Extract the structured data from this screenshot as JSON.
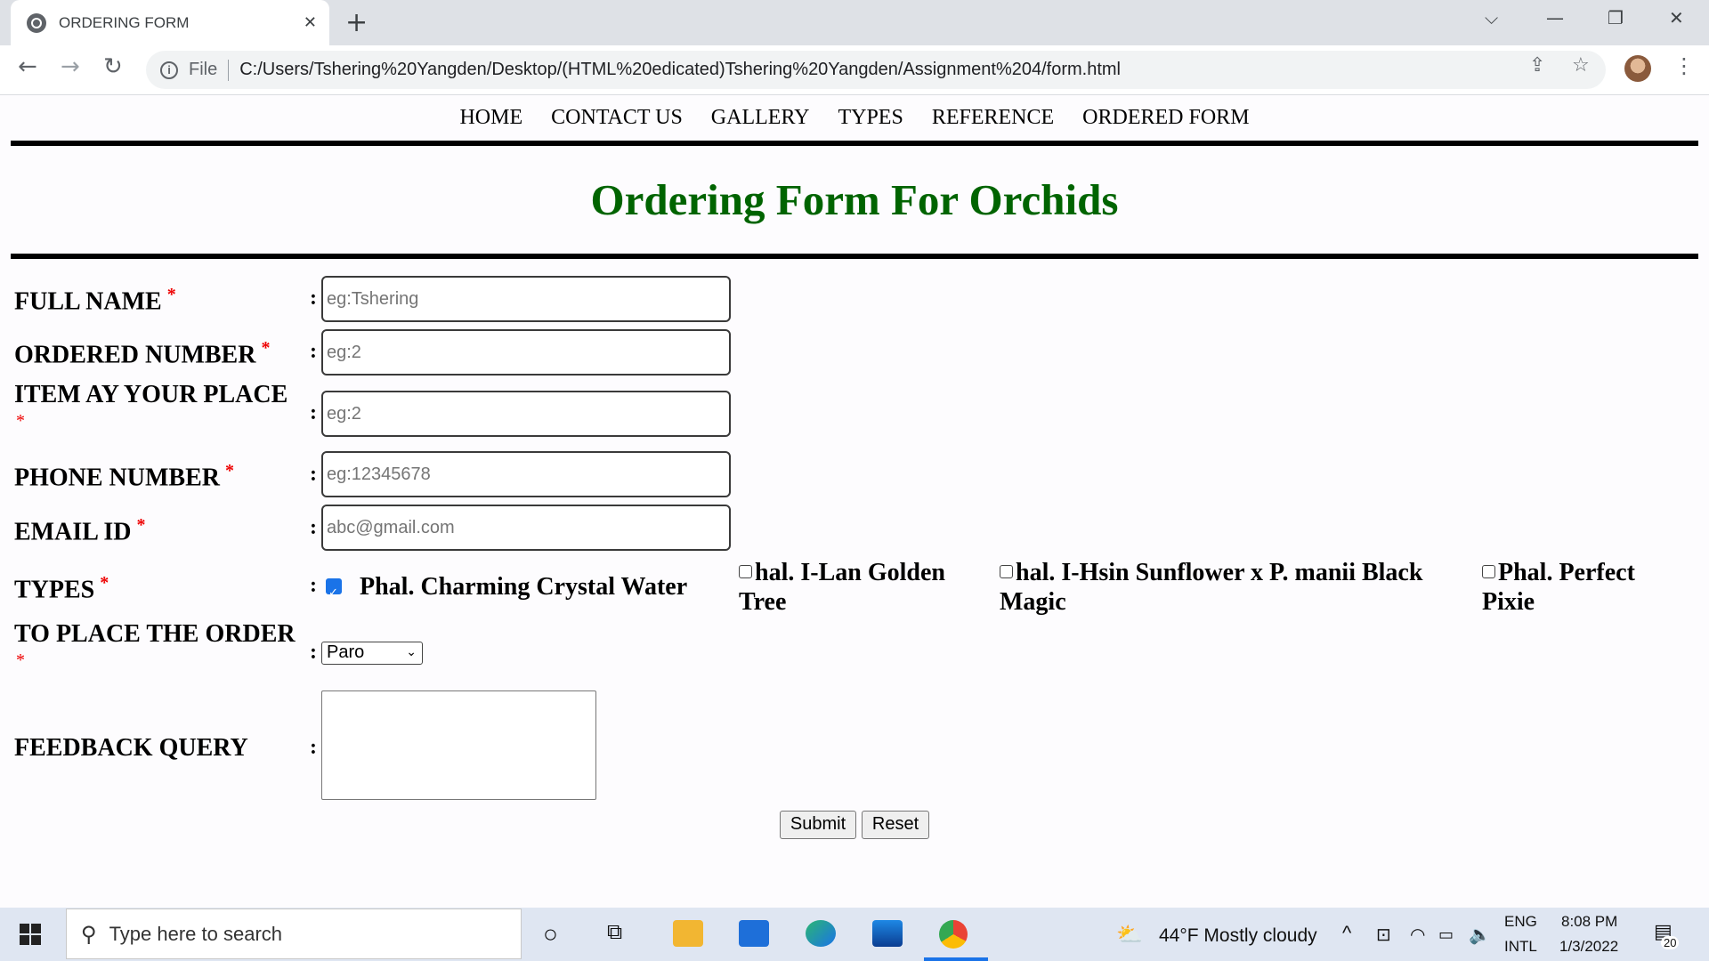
{
  "browser": {
    "tab_title": "ORDERING FORM",
    "tab_close": "✕",
    "new_tab": "+",
    "url_scheme_label": "File",
    "url": "C:/Users/Tshering%20Yangden/Desktop/(HTML%20edicated)Tshering%20Yangden/Assignment%204/form.html"
  },
  "nav": {
    "items": [
      "HOME",
      "CONTACT US",
      "GALLERY",
      "TYPES",
      "REFERENCE",
      "ORDERED FORM"
    ]
  },
  "heading": "Ordering Form For Orchids",
  "form": {
    "required_mark": "*",
    "colon": ":",
    "full_name": {
      "label": "FULL NAME",
      "placeholder": "eg:Tshering"
    },
    "ordered_number": {
      "label": "ORDERED NUMBER",
      "placeholder": "eg:2"
    },
    "item_at_place": {
      "label": "ITEM AY YOUR PLACE",
      "placeholder": "eg:2"
    },
    "phone": {
      "label": "PHONE NUMBER",
      "placeholder": "eg:12345678"
    },
    "email": {
      "label": "EMAIL ID",
      "placeholder": "abc@gmail.com"
    },
    "types": {
      "label": "TYPES",
      "options": [
        {
          "line1": "Phal. Charming Crystal Water",
          "line2": "",
          "checked": true
        },
        {
          "line1": "hal. I-Lan Golden",
          "line2": "Tree",
          "checked": false
        },
        {
          "line1": "hal. I-Hsin Sunflower x P. manii Black",
          "line2": "Magic",
          "checked": false
        },
        {
          "line1": "Phal. Perfect",
          "line2": "Pixie",
          "checked": false
        }
      ]
    },
    "place_order": {
      "label": "TO PLACE THE ORDER",
      "selected": "Paro"
    },
    "feedback": {
      "label": "FEEDBACK QUERY"
    },
    "submit_label": "Submit",
    "reset_label": "Reset"
  },
  "taskbar": {
    "search_placeholder": "Type here to search",
    "weather": "44°F  Mostly cloudy",
    "lang_top": "ENG",
    "lang_bottom": "INTL",
    "time": "8:08 PM",
    "date": "1/3/2022",
    "notifications": "20"
  },
  "colors": {
    "heading": "#006400",
    "required": "#e00000",
    "checkbox_checked": "#1a73e8"
  }
}
